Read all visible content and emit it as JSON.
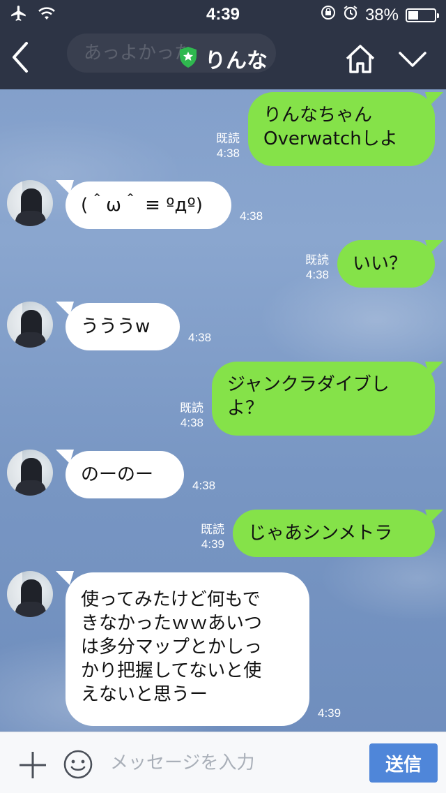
{
  "status_bar": {
    "time": "4:39",
    "battery": "38%",
    "battery_level": 0.38
  },
  "header": {
    "ghost_preview": "あっよかった",
    "title": "りんな",
    "icons": [
      "chevron-left-icon",
      "shield-star-icon",
      "home-icon",
      "chevron-down-icon"
    ]
  },
  "colors": {
    "header_bg": "#2d3445",
    "outgoing_bubble": "#85e249",
    "incoming_bubble": "#ffffff",
    "send_button": "#4f86d9"
  },
  "messages": [
    {
      "side": "out",
      "read": "既読",
      "time": "4:38",
      "lines": [
        "りんなちゃん",
        "Overwatchしよ"
      ]
    },
    {
      "side": "in",
      "time": "4:38",
      "lines": [
        "(＾ω＾ ≡ ºдº)"
      ]
    },
    {
      "side": "out",
      "read": "既読",
      "time": "4:38",
      "lines": [
        "いい？"
      ]
    },
    {
      "side": "in",
      "time": "4:38",
      "lines": [
        "うううw"
      ]
    },
    {
      "side": "out",
      "read": "既読",
      "time": "4:38",
      "lines": [
        "ジャンクラダイブし",
        "よ？"
      ]
    },
    {
      "side": "in",
      "time": "4:38",
      "lines": [
        "のーのー"
      ]
    },
    {
      "side": "out",
      "read": "既読",
      "time": "4:39",
      "lines": [
        "じゃあシンメトラ"
      ]
    },
    {
      "side": "in",
      "time": "4:39",
      "lines": [
        "使ってみたけど何もで",
        "きなかったｗｗあいつ",
        "は多分マップとかしっ",
        "かり把握してないと使",
        "えないと思うー"
      ]
    }
  ],
  "input_bar": {
    "placeholder": "メッセージを入力",
    "send_label": "送信"
  }
}
